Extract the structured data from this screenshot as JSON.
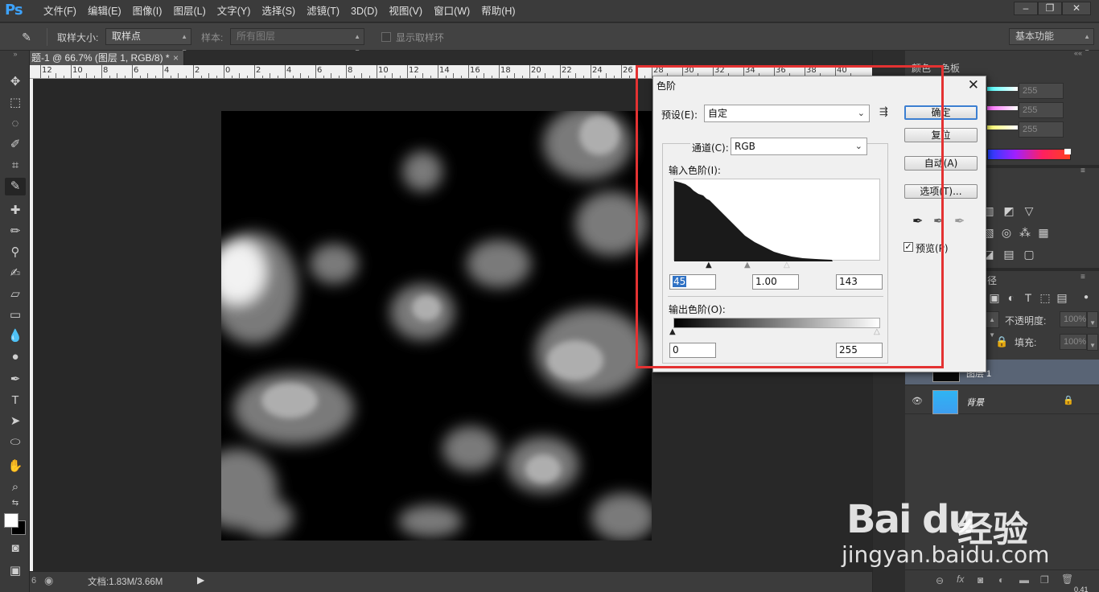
{
  "app": {
    "logo": "Ps"
  },
  "menu": {
    "items": [
      "文件(F)",
      "编辑(E)",
      "图像(I)",
      "图层(L)",
      "文字(Y)",
      "选择(S)",
      "滤镜(T)",
      "3D(D)",
      "视图(V)",
      "窗口(W)",
      "帮助(H)"
    ],
    "window_buttons": {
      "minimize": "–",
      "restore": "❐",
      "close": "✕"
    }
  },
  "options_bar": {
    "sample_size_label": "取样大小:",
    "sample_size_value": "取样点",
    "sample_label": "样本:",
    "sample_value": "所有图层",
    "show_ring_label": "显示取样环",
    "workspace": "基本功能"
  },
  "document": {
    "tab_title": "题-1 @ 66.7% (图层 1, RGB/8) *",
    "tab_close": "×",
    "ruler_labels": [
      "12",
      "10",
      "8",
      "6",
      "4",
      "2",
      "0",
      "2",
      "4",
      "6",
      "8",
      "10",
      "12",
      "14",
      "16",
      "18",
      "20",
      "22",
      "24",
      "26",
      "28",
      "30",
      "32",
      "34",
      "36",
      "38",
      "40"
    ],
    "status_text": "文档:1.83M/3.66M"
  },
  "right_panels": {
    "color_tab": "颜色",
    "swatches_tab": "色板",
    "slider_values": [
      "255",
      "255",
      "255"
    ],
    "layers_opacity_label": "不透明度:",
    "layers_opacity_value": "100%",
    "layers_fill_label": "填充:",
    "layers_fill_value": "100%",
    "paths_tab_fragment": "径",
    "layer1_name": "图层 1",
    "background_layer_name": "背景",
    "bottom_label": "0.41"
  },
  "levels_dialog": {
    "title": "色阶",
    "close": "✕",
    "preset_label": "预设(E):",
    "preset_value": "自定",
    "channel_label": "通道(C):",
    "channel_value": "RGB",
    "input_levels_label": "输入色阶(I):",
    "input_black": "45",
    "input_gamma": "1.00",
    "input_white": "143",
    "output_levels_label": "输出色阶(O):",
    "output_black": "0",
    "output_white": "255",
    "buttons": {
      "ok": "确定",
      "reset": "复位",
      "auto": "自动(A)",
      "options": "选项(T)..."
    },
    "preview_label": "预览(P)",
    "preview_checked": true
  },
  "watermark": {
    "brand": "Bai du",
    "sub": "经验",
    "url": "jingyan.baidu.com"
  },
  "colors": {
    "accent_blue": "#3da3ff",
    "highlight_box": "#e43232",
    "selection": "#3072c4"
  }
}
